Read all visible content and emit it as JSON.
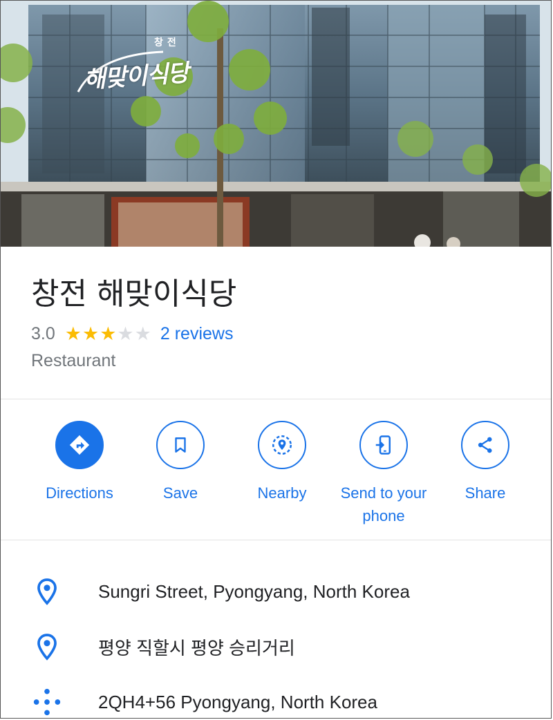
{
  "place": {
    "name": "창전 해맞이식당",
    "rating": "3.0",
    "stars_filled": 3,
    "stars_total": 5,
    "reviews_link": "2 reviews",
    "category": "Restaurant",
    "sign_text": "해맞이식당",
    "sign_small": "창전"
  },
  "actions": [
    {
      "label": "Directions",
      "icon": "directions-icon"
    },
    {
      "label": "Save",
      "icon": "bookmark-icon"
    },
    {
      "label": "Nearby",
      "icon": "nearby-icon"
    },
    {
      "label": "Send to your\nphone",
      "icon": "send-to-phone-icon"
    },
    {
      "label": "Share",
      "icon": "share-icon"
    }
  ],
  "info": {
    "address_en": "Sungri Street, Pyongyang, North Korea",
    "address_ko": "평양 직할시 평양 승리거리",
    "plus_code": "2QH4+56 Pyongyang, North Korea"
  },
  "colors": {
    "accent": "#1a73e8",
    "star": "#fbbc04",
    "star_empty": "#dadce0",
    "text_primary": "#202124",
    "text_secondary": "#70757a"
  }
}
